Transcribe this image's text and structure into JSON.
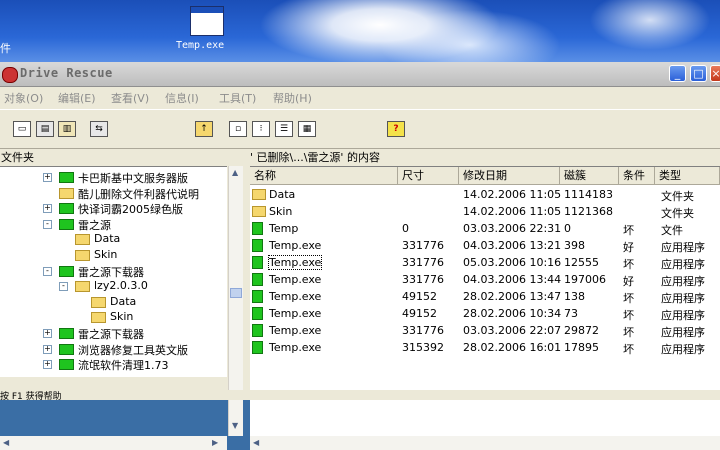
{
  "desktop": {
    "left_label": "件",
    "icon_label": "Temp.exe"
  },
  "window": {
    "title": "Drive Rescue",
    "controls": {
      "minimize": "_",
      "maximize": "□",
      "close": "×"
    }
  },
  "menu": [
    {
      "label": "对象(O)"
    },
    {
      "label": "编辑(E)"
    },
    {
      "label": "查看(V)"
    },
    {
      "label": "信息(I)"
    },
    {
      "label": "工具(T)"
    },
    {
      "label": "帮助(H)"
    }
  ],
  "toolbar": {
    "help_label": "?"
  },
  "left_panel": {
    "header": "文件夹",
    "tree": [
      {
        "label": "卡巴斯基中文服务器版",
        "expander": "+",
        "color": "green"
      },
      {
        "label": "酷儿删除文件利器代说明",
        "expander": "",
        "color": "yellow"
      },
      {
        "label": "快译词霸2005绿色版",
        "expander": "+",
        "color": "green"
      },
      {
        "label": "雷之源",
        "expander": "-",
        "color": "green"
      },
      {
        "label": "Data",
        "expander": "",
        "color": "yellow"
      },
      {
        "label": "Skin",
        "expander": "",
        "color": "yellow"
      },
      {
        "label": "雷之源下载器",
        "expander": "-",
        "color": "green"
      },
      {
        "label": "lzy2.0.3.0",
        "expander": "-",
        "color": "yellow"
      },
      {
        "label": "Data",
        "expander": "",
        "color": "yellow"
      },
      {
        "label": "Skin",
        "expander": "",
        "color": "yellow"
      },
      {
        "label": "雷之源下载器",
        "expander": "+",
        "color": "green"
      },
      {
        "label": "浏览器修复工具英文版",
        "expander": "+",
        "color": "green"
      },
      {
        "label": "流氓软件清理1.73",
        "expander": "+",
        "color": "green"
      }
    ]
  },
  "right_panel": {
    "header": "' 已删除\\...\\雷之源' 的内容",
    "columns": [
      "名称",
      "尺寸",
      "修改日期",
      "磁簇",
      "条件",
      "类型"
    ],
    "rows": [
      {
        "name": "Data",
        "size": "",
        "date": "14.02.2006 11:05",
        "cluster": "1114183",
        "cond": "",
        "type": "文件夹",
        "icon": "folder"
      },
      {
        "name": "Skin",
        "size": "",
        "date": "14.02.2006 11:05",
        "cluster": "1121368",
        "cond": "",
        "type": "文件夹",
        "icon": "folder"
      },
      {
        "name": "Temp",
        "size": "0",
        "date": "03.03.2006 22:31",
        "cluster": "0",
        "cond": "坏",
        "type": "文件",
        "icon": "file"
      },
      {
        "name": "Temp.exe",
        "size": "331776",
        "date": "04.03.2006 13:21",
        "cluster": "398",
        "cond": "好",
        "type": "应用程序",
        "icon": "file"
      },
      {
        "name": "Temp.exe",
        "size": "331776",
        "date": "05.03.2006 10:16",
        "cluster": "12555",
        "cond": "坏",
        "type": "应用程序",
        "icon": "file"
      },
      {
        "name": "Temp.exe",
        "size": "331776",
        "date": "04.03.2006 13:44",
        "cluster": "197006",
        "cond": "好",
        "type": "应用程序",
        "icon": "file"
      },
      {
        "name": "Temp.exe",
        "size": "49152",
        "date": "28.02.2006 13:47",
        "cluster": "138",
        "cond": "坏",
        "type": "应用程序",
        "icon": "file"
      },
      {
        "name": "Temp.exe",
        "size": "49152",
        "date": "28.02.2006 10:34",
        "cluster": "73",
        "cond": "坏",
        "type": "应用程序",
        "icon": "file"
      },
      {
        "name": "Temp.exe",
        "size": "331776",
        "date": "03.03.2006 22:07",
        "cluster": "29872",
        "cond": "坏",
        "type": "应用程序",
        "icon": "file"
      },
      {
        "name": "Temp.exe",
        "size": "315392",
        "date": "28.02.2006 16:01",
        "cluster": "17895",
        "cond": "坏",
        "type": "应用程序",
        "icon": "file"
      }
    ]
  },
  "statusbar": {
    "text": "按 F1 获得帮助"
  }
}
